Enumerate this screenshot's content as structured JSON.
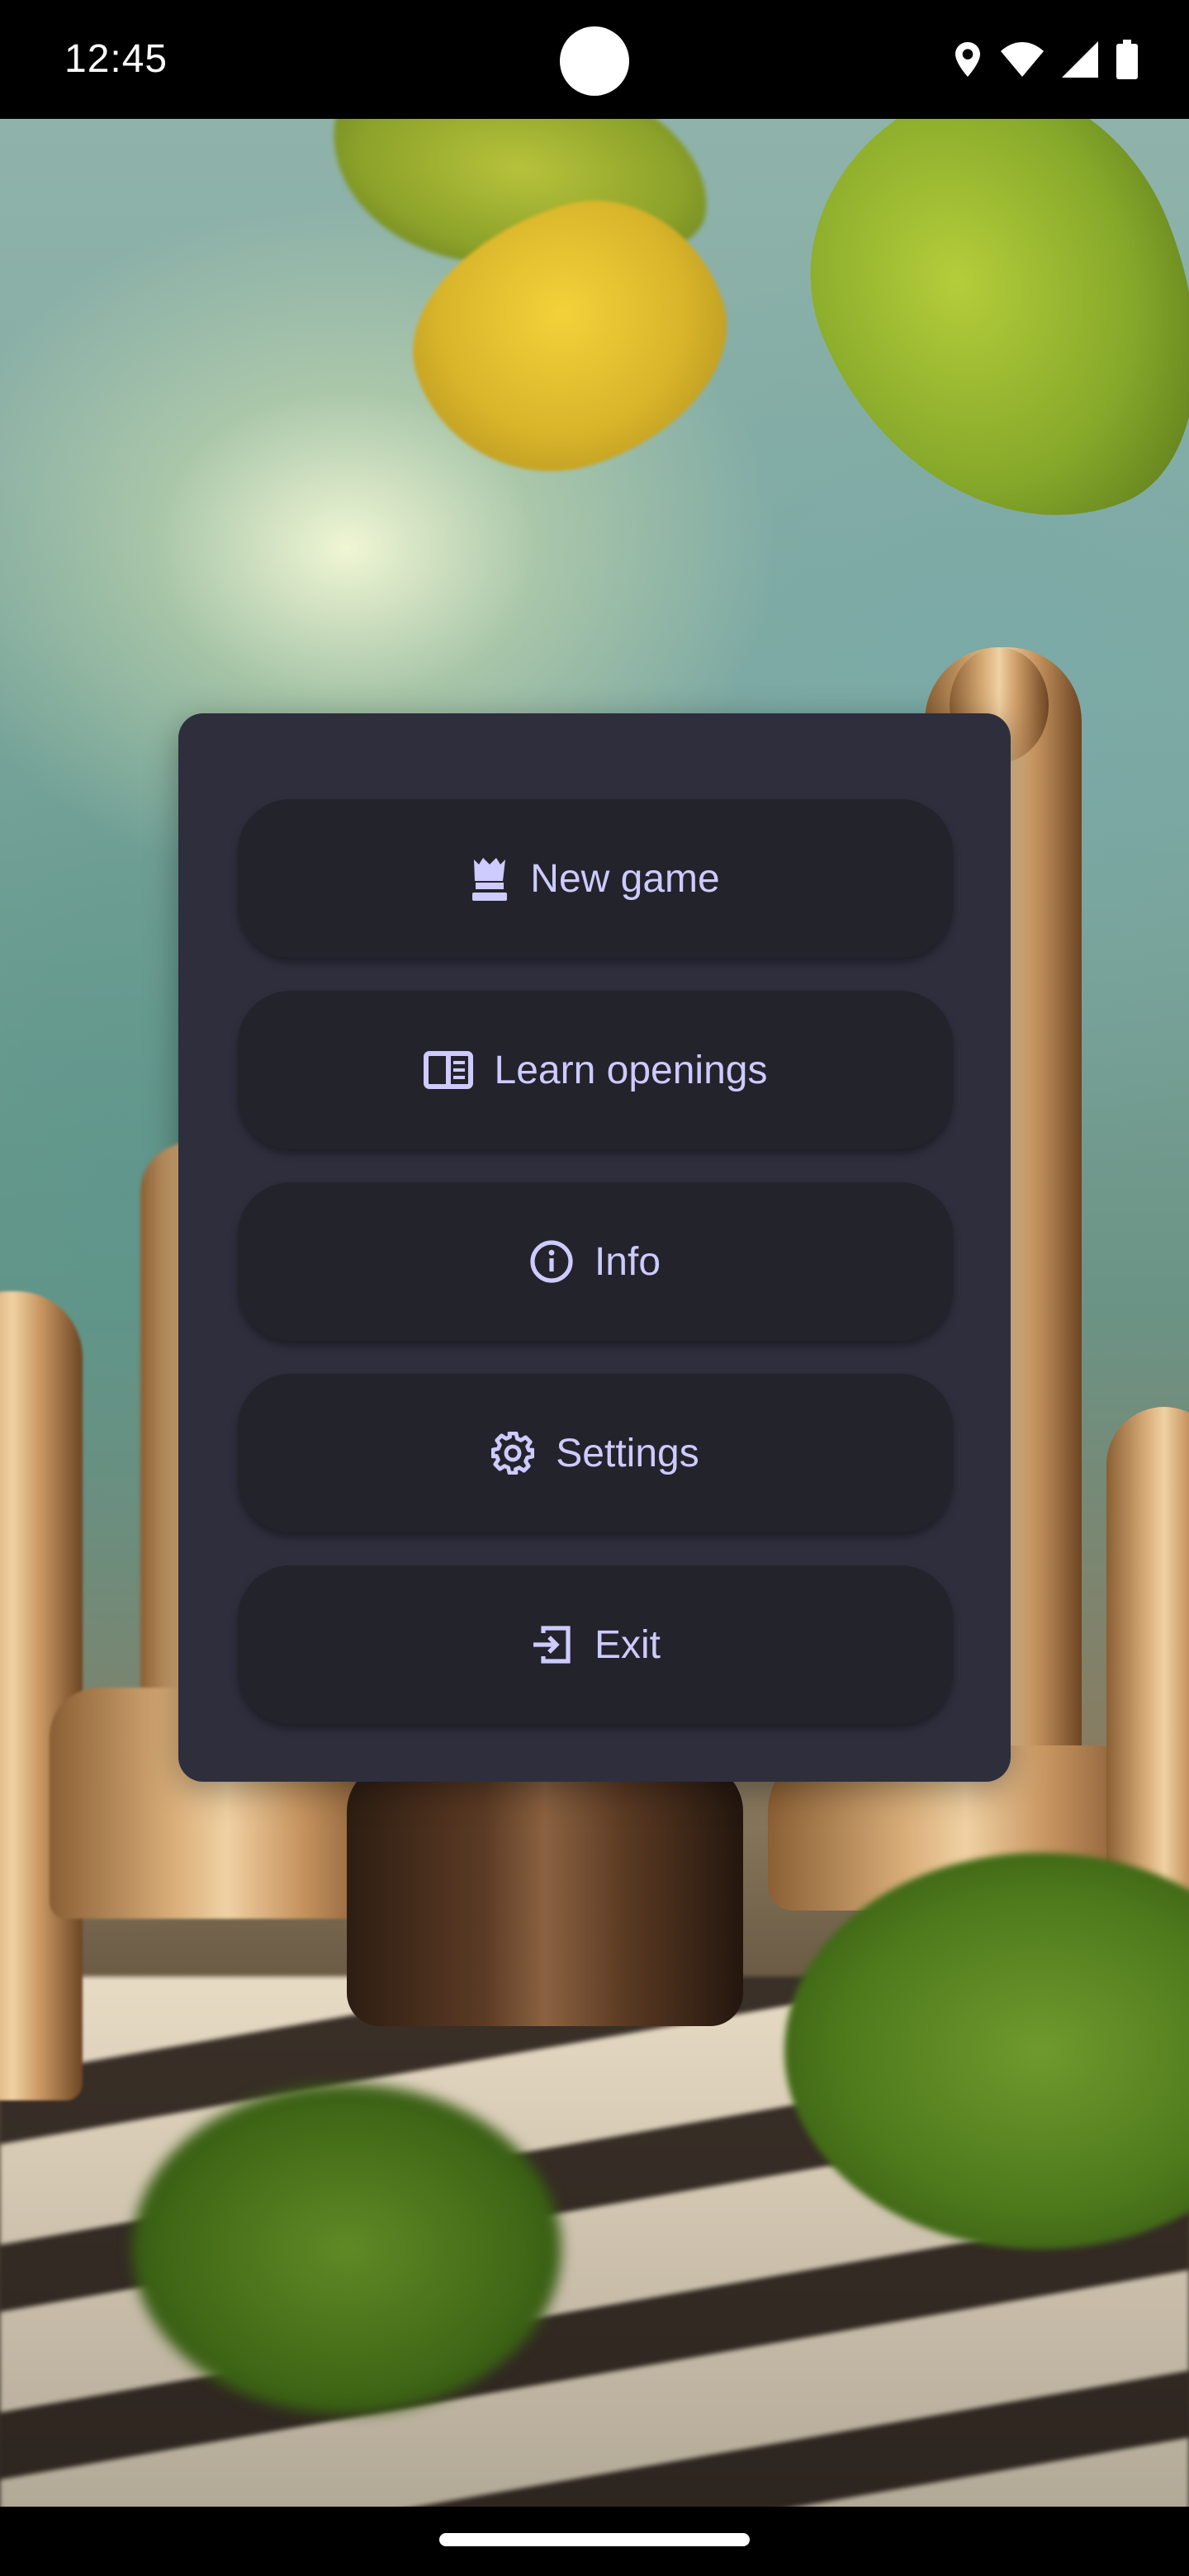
{
  "status_bar": {
    "time": "12:45",
    "icons": [
      "location-icon",
      "wifi-icon",
      "signal-icon",
      "battery-icon"
    ]
  },
  "background": {
    "description_icon": "chess-background-image"
  },
  "menu": {
    "items": [
      {
        "label": "New game",
        "icon": "chess-queen-icon"
      },
      {
        "label": "Learn openings",
        "icon": "book-icon"
      },
      {
        "label": "Info",
        "icon": "info-icon"
      },
      {
        "label": "Settings",
        "icon": "gear-icon"
      },
      {
        "label": "Exit",
        "icon": "exit-icon"
      }
    ]
  },
  "colors": {
    "card": "#2e2e3d",
    "button": "#23232c",
    "accent": "#cdcbff"
  }
}
